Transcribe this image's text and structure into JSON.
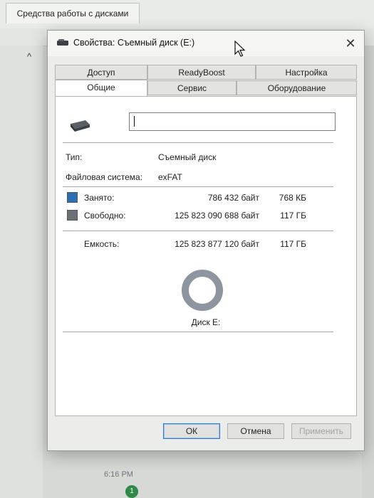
{
  "background": {
    "ribbon_tab": "Средства работы с дисками",
    "time": "6:16 PM",
    "notification_count": "1"
  },
  "dialog": {
    "title": "Свойства: Съемный диск (E:)",
    "close_label": "✕",
    "tabs_back": [
      "Доступ",
      "ReadyBoost",
      "Настройка"
    ],
    "tabs_front": [
      "Общие",
      "Сервис",
      "Оборудование"
    ],
    "active_tab": "Общие",
    "volume_name": "",
    "type_label": "Тип:",
    "type_value": "Съемный диск",
    "fs_label": "Файловая система:",
    "fs_value": "exFAT",
    "used_label": "Занято:",
    "used_bytes": "786 432 байт",
    "used_short": "768 КБ",
    "free_label": "Свободно:",
    "free_bytes": "125 823 090 688 байт",
    "free_short": "117 ГБ",
    "capacity_label": "Емкость:",
    "capacity_bytes": "125 823 877 120 байт",
    "capacity_short": "117 ГБ",
    "disk_label": "Диск E:",
    "buttons": {
      "ok": "ОК",
      "cancel": "Отмена",
      "apply": "Применить"
    }
  },
  "colors": {
    "used": "#2a6fb4",
    "free": "#6b6f78",
    "donut_free": "#8f959e",
    "accent": "#2b78d0"
  },
  "usage": {
    "used_fraction": 6.25e-06
  }
}
